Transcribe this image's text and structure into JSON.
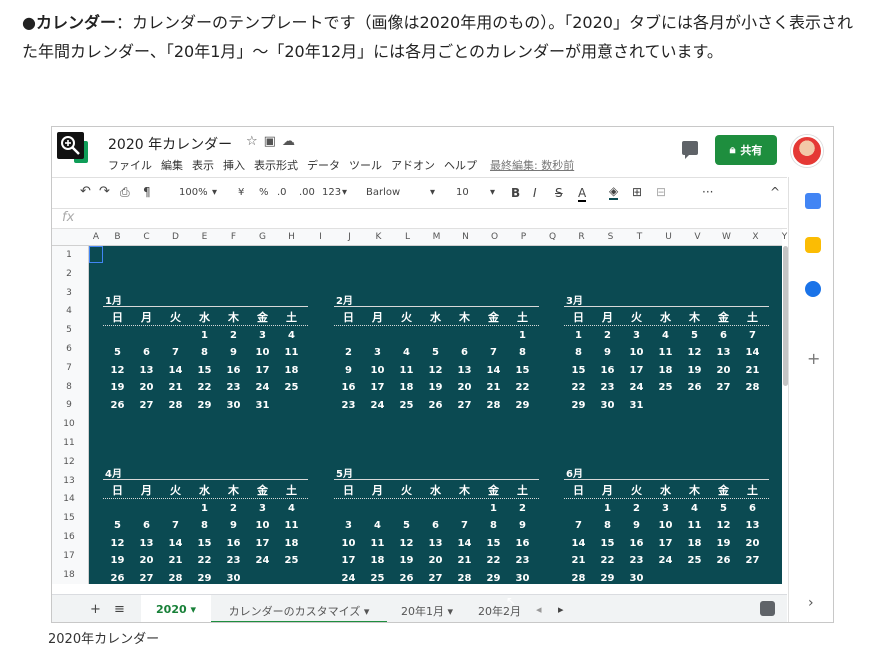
{
  "article": {
    "bullet": "●",
    "bold_label": "カレンダー",
    "text": "：カレンダーのテンプレートです（画像は2020年用のもの）。「2020」タブには各月が小さく表示された年間カレンダー、「20年1月」〜「20年12月」には各月ごとのカレンダーが用意されています。"
  },
  "caption": "2020年カレンダー",
  "app": {
    "doc_title": "2020 年カレンダー",
    "title_icons": [
      "star-icon",
      "folder-move-icon",
      "cloud-status-icon"
    ],
    "menus": [
      "ファイル",
      "編集",
      "表示",
      "挿入",
      "表示形式",
      "データ",
      "ツール",
      "アドオン",
      "ヘルプ"
    ],
    "last_edit": "最終編集: 数秒前",
    "share_label": "共有",
    "brand_color": "#1e8e3e",
    "sheet_bg_color": "#0b4a52"
  },
  "toolbar": {
    "undo": "↶",
    "redo": "↷",
    "print": "⎙",
    "paint": "¶",
    "zoom": "100%",
    "currency": "¥",
    "percent": "%",
    "dec_less": ".0",
    "dec_more": ".00",
    "format_123": "123",
    "font": "Barlow",
    "font_size": "10",
    "bold": "B",
    "italic": "I",
    "strike": "S",
    "text_color": "A",
    "more": "···",
    "collapse": "^"
  },
  "formula_bar": {
    "fx": "fx",
    "value": ""
  },
  "columns": [
    "A",
    "B",
    "C",
    "D",
    "E",
    "F",
    "G",
    "H",
    "I",
    "J",
    "K",
    "L",
    "M",
    "N",
    "O",
    "P",
    "Q",
    "R",
    "S",
    "T",
    "U",
    "V",
    "W",
    "X",
    "Y"
  ],
  "rows": [
    "1",
    "2",
    "3",
    "4",
    "5",
    "6",
    "7",
    "8",
    "9",
    "10",
    "11",
    "12",
    "13",
    "14",
    "15",
    "16",
    "17",
    "18"
  ],
  "weekdays": [
    "日",
    "月",
    "火",
    "水",
    "木",
    "金",
    "土"
  ],
  "months": [
    {
      "label": "1月",
      "weeks": [
        [
          "",
          "",
          "",
          "1",
          "2",
          "3",
          "4"
        ],
        [
          "5",
          "6",
          "7",
          "8",
          "9",
          "10",
          "11"
        ],
        [
          "12",
          "13",
          "14",
          "15",
          "16",
          "17",
          "18"
        ],
        [
          "19",
          "20",
          "21",
          "22",
          "23",
          "24",
          "25"
        ],
        [
          "26",
          "27",
          "28",
          "29",
          "30",
          "31",
          ""
        ]
      ]
    },
    {
      "label": "2月",
      "weeks": [
        [
          "",
          "",
          "",
          "",
          "",
          "",
          "1"
        ],
        [
          "2",
          "3",
          "4",
          "5",
          "6",
          "7",
          "8"
        ],
        [
          "9",
          "10",
          "11",
          "12",
          "13",
          "14",
          "15"
        ],
        [
          "16",
          "17",
          "18",
          "19",
          "20",
          "21",
          "22"
        ],
        [
          "23",
          "24",
          "25",
          "26",
          "27",
          "28",
          "29"
        ]
      ]
    },
    {
      "label": "3月",
      "weeks": [
        [
          "1",
          "2",
          "3",
          "4",
          "5",
          "6",
          "7"
        ],
        [
          "8",
          "9",
          "10",
          "11",
          "12",
          "13",
          "14"
        ],
        [
          "15",
          "16",
          "17",
          "18",
          "19",
          "20",
          "21"
        ],
        [
          "22",
          "23",
          "24",
          "25",
          "26",
          "27",
          "28"
        ],
        [
          "29",
          "30",
          "31",
          "",
          "",
          "",
          ""
        ]
      ]
    },
    {
      "label": "4月",
      "weeks": [
        [
          "",
          "",
          "",
          "1",
          "2",
          "3",
          "4"
        ],
        [
          "5",
          "6",
          "7",
          "8",
          "9",
          "10",
          "11"
        ],
        [
          "12",
          "13",
          "14",
          "15",
          "16",
          "17",
          "18"
        ],
        [
          "19",
          "20",
          "21",
          "22",
          "23",
          "24",
          "25"
        ],
        [
          "26",
          "27",
          "28",
          "29",
          "30",
          "",
          ""
        ]
      ]
    },
    {
      "label": "5月",
      "weeks": [
        [
          "",
          "",
          "",
          "",
          "",
          "1",
          "2"
        ],
        [
          "3",
          "4",
          "5",
          "6",
          "7",
          "8",
          "9"
        ],
        [
          "10",
          "11",
          "12",
          "13",
          "14",
          "15",
          "16"
        ],
        [
          "17",
          "18",
          "19",
          "20",
          "21",
          "22",
          "23"
        ],
        [
          "24",
          "25",
          "26",
          "27",
          "28",
          "29",
          "30"
        ]
      ]
    },
    {
      "label": "6月",
      "weeks": [
        [
          "",
          "1",
          "2",
          "3",
          "4",
          "5",
          "6"
        ],
        [
          "7",
          "8",
          "9",
          "10",
          "11",
          "12",
          "13"
        ],
        [
          "14",
          "15",
          "16",
          "17",
          "18",
          "19",
          "20"
        ],
        [
          "21",
          "22",
          "23",
          "24",
          "25",
          "26",
          "27"
        ],
        [
          "28",
          "29",
          "30",
          "",
          "",
          "",
          ""
        ]
      ]
    }
  ],
  "tabs": {
    "add": "+",
    "list": "≡",
    "items": [
      {
        "label": "2020 ▾",
        "active": true
      },
      {
        "label": "カレンダーのカスタマイズ ▾",
        "active": false
      },
      {
        "label": "20年1月 ▾",
        "active": false
      },
      {
        "label": "20年2月",
        "active": false
      }
    ],
    "prev": "◂",
    "next": "▸"
  },
  "side_panel": {
    "icons": [
      {
        "name": "calendar-icon",
        "color": "#4285f4"
      },
      {
        "name": "keep-icon",
        "color": "#fbbc04"
      },
      {
        "name": "tasks-icon",
        "color": "#1a73e8"
      }
    ],
    "plus": "+",
    "expand": "›"
  }
}
